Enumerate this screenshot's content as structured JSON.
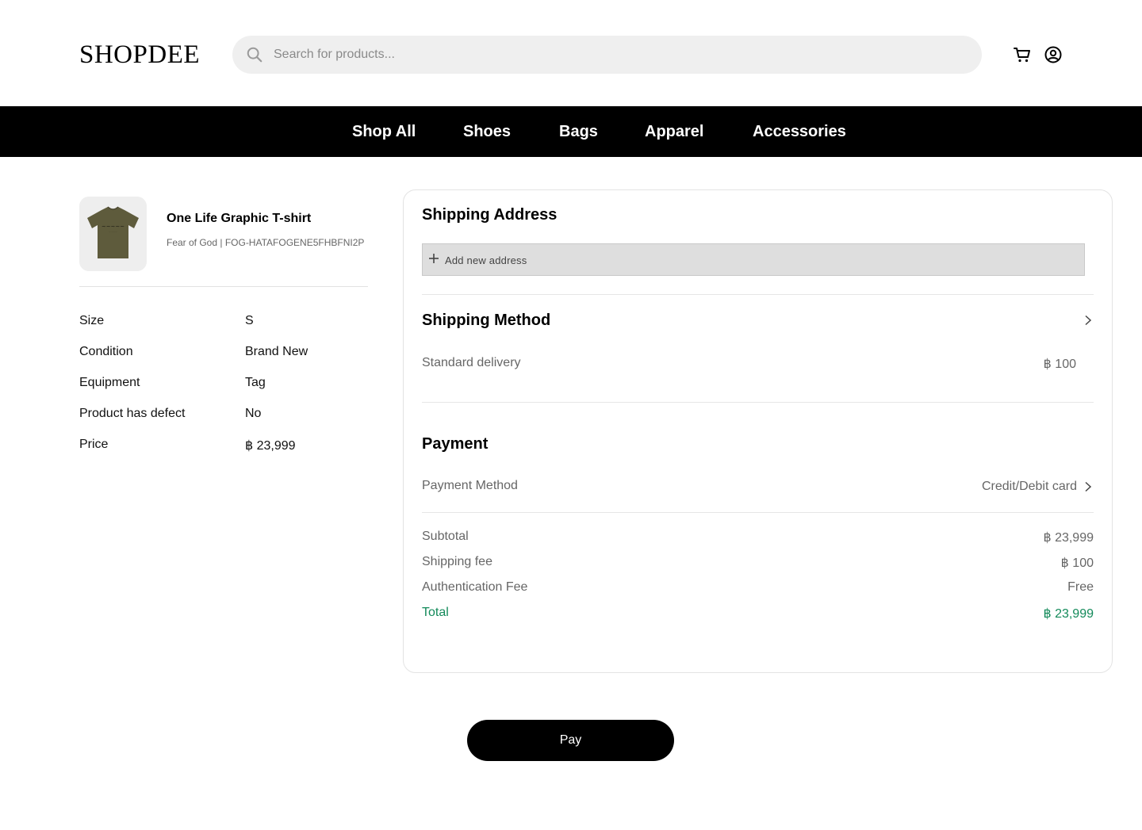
{
  "header": {
    "logo": "SHOPDEE",
    "search_placeholder": "Search for products...",
    "icons": [
      "search-icon",
      "cart-icon",
      "account-icon"
    ]
  },
  "nav": {
    "items": [
      "Shop All",
      "Shoes",
      "Bags",
      "Apparel",
      "Accessories"
    ]
  },
  "product": {
    "name": "One Life Graphic T-shirt",
    "subtitle": "Fear of God | FOG-HATAFOGENE5FHBFNI2P",
    "thumbnail_color": "#5e5b3c",
    "specs": [
      {
        "label": "Size",
        "value": "S"
      },
      {
        "label": "Condition",
        "value": "Brand New"
      },
      {
        "label": "Equipment",
        "value": "Tag"
      },
      {
        "label": "Product has defect",
        "value": "No"
      },
      {
        "label": "Price",
        "value": "฿ 23,999"
      }
    ]
  },
  "checkout": {
    "shipping_address": {
      "title": "Shipping Address",
      "add_label": "Add new address"
    },
    "shipping_method": {
      "title": "Shipping Method",
      "option_label": "Standard delivery",
      "option_price": "฿ 100"
    },
    "payment": {
      "title": "Payment",
      "method_label": "Payment Method",
      "method_value": "Credit/Debit card"
    },
    "summary": [
      {
        "label": "Subtotal",
        "value": "฿ 23,999"
      },
      {
        "label": "Shipping fee",
        "value": "฿ 100"
      },
      {
        "label": "Authentication Fee",
        "value": "Free"
      },
      {
        "label": "Total",
        "value": "฿ 23,999"
      }
    ],
    "total_color": "#138a5a"
  },
  "actions": {
    "pay_label": "Pay"
  }
}
